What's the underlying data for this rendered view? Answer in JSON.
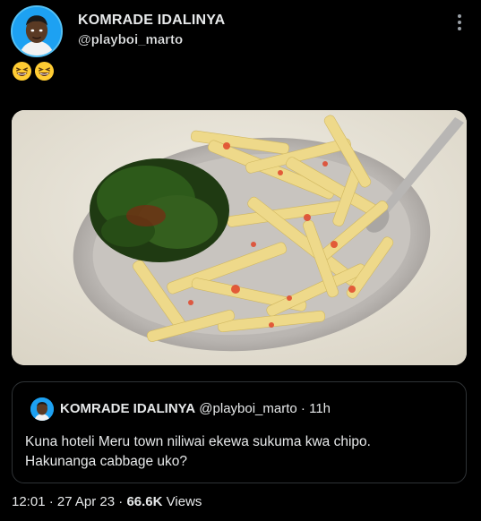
{
  "post": {
    "author_name": "KOMRADE IDALINYA",
    "author_handle": "@playboi_marto",
    "emojis": [
      "grinning-squinting-face",
      "grinning-squinting-face"
    ],
    "image_alt_icon": "plate-of-fries-with-sukuma-icon"
  },
  "quoted": {
    "author_name": "KOMRADE IDALINYA",
    "author_handle": "@playboi_marto",
    "separator": "·",
    "age": "11h",
    "text_line1": "Kuna hoteli Meru town niliwai ekewa sukuma kwa chipo.",
    "text_line2": "Hakunanga cabbage uko?"
  },
  "footer": {
    "time": "12:01",
    "separator1": "·",
    "date": "27 Apr 23",
    "separator2": "·",
    "views_count": "66.6K",
    "views_label": "Views"
  },
  "colors": {
    "background": "#000000",
    "text": "#e7e9ea",
    "avatar_blue": "#1da1f2",
    "border": "#2f3336"
  }
}
